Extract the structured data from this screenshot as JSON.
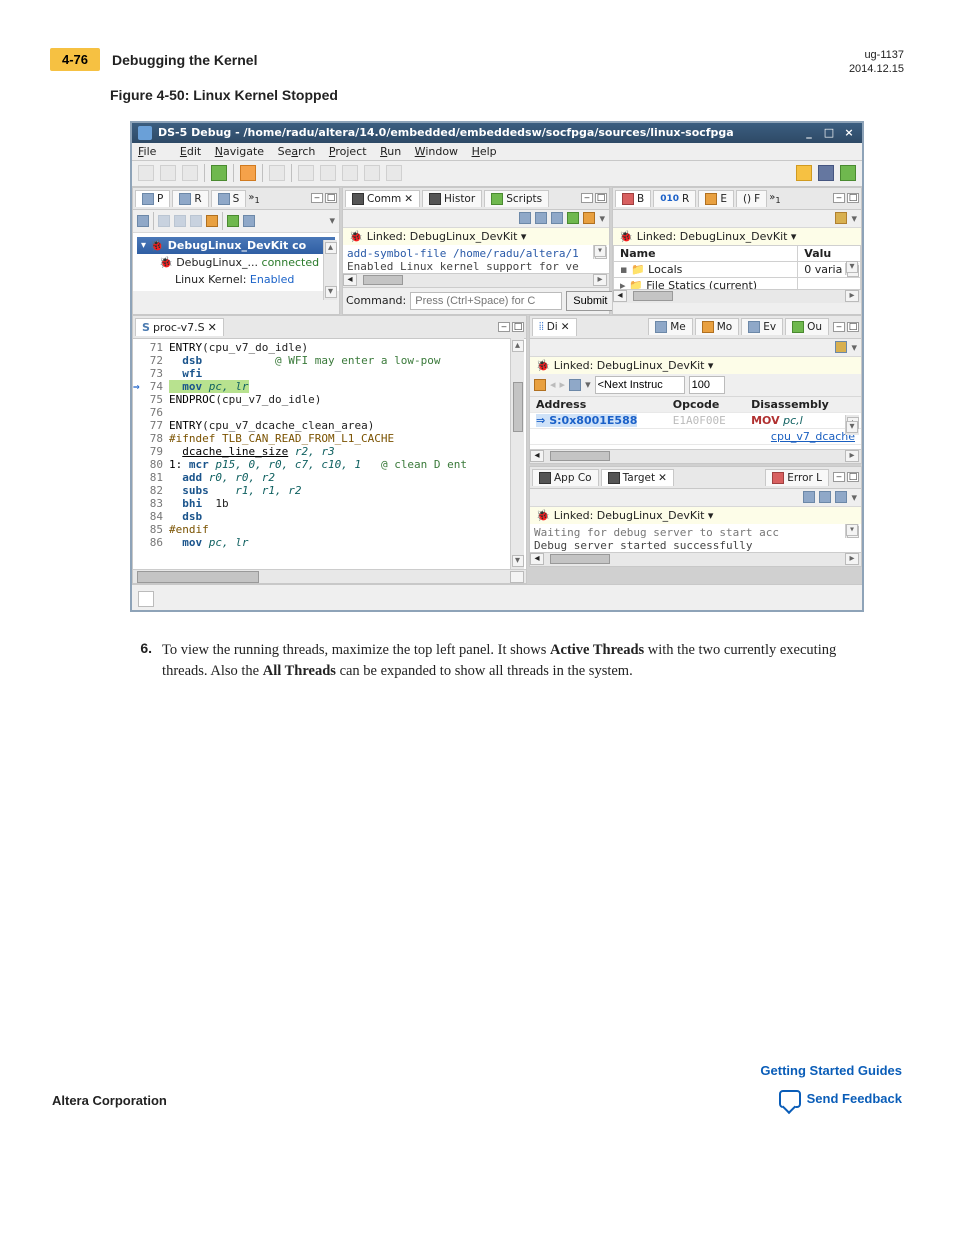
{
  "doc": {
    "page_number": "4-76",
    "section_title": "Debugging the Kernel",
    "doc_id": "ug-1137",
    "doc_date": "2014.12.15",
    "figure_caption": "Figure 4-50: Linux Kernel Stopped"
  },
  "window": {
    "title": "DS-5 Debug - /home/radu/altera/14.0/embedded/embeddedsw/socfpga/sources/linux-socfpga",
    "min": "_",
    "restore": "□",
    "close": "×"
  },
  "menubar": {
    "file": "File",
    "edit": "Edit",
    "navigate": "Navigate",
    "search": "Search",
    "project": "Project",
    "run": "Run",
    "window": "Window",
    "help": "Help"
  },
  "debug_control": {
    "tab_labels": [
      "P",
      "R",
      "S",
      "1"
    ],
    "selected": "DebugLinux_DevKit co",
    "status_line": "DebugLinux_... connected",
    "kernel_line_label": "Linux Kernel:",
    "kernel_line_value": "Enabled"
  },
  "commands": {
    "tab_comm": "Comm",
    "tab_histor": "Histor",
    "tab_scripts": "Scripts",
    "linked_label": "Linked: DebugLinux_DevKit",
    "line1": "add-symbol-file /home/radu/altera/1",
    "line2": "Enabled Linux kernel support for ve",
    "cmd_label": "Command:",
    "cmd_placeholder": "Press (Ctrl+Space) for C",
    "submit_label": "Submit"
  },
  "variables": {
    "tabs": [
      "B",
      "R",
      "E",
      "()",
      "F",
      "1"
    ],
    "linked_label": "Linked: DebugLinux_DevKit",
    "col_name": "Name",
    "col_value": "Valu",
    "row_locals": "Locals",
    "row_locals_val": "0 varia",
    "row_statics": "File Statics (current)"
  },
  "source": {
    "tab_label": "proc-v7.S",
    "lines": [
      {
        "n": "71",
        "t": "ENTRY",
        "a": "(cpu_v7_do_idle)"
      },
      {
        "n": "72",
        "i": "  ",
        "m": "dsb",
        "c": "          @ WFI may enter a low-pow"
      },
      {
        "n": "73",
        "i": "  ",
        "m": "wfi"
      },
      {
        "n": "74",
        "pc": true,
        "i": "  ",
        "m": "mov",
        "r": "pc, lr"
      },
      {
        "n": "75",
        "t": "ENDPROC",
        "a": "(cpu_v7_do_idle)"
      },
      {
        "n": "76"
      },
      {
        "n": "77",
        "t": "ENTRY",
        "a": "(cpu_v7_dcache_clean_area)"
      },
      {
        "n": "78",
        "d": "#ifndef TLB_CAN_READ_FROM_L1_CACHE"
      },
      {
        "n": "79",
        "i": "  ",
        "m2": "dcache_line_size",
        "r": "r2, r3"
      },
      {
        "n": "80",
        "lbl": "1:",
        "m": "mcr",
        "r": "p15, 0, r0, c7, c10, 1",
        "c": "   @ clean D ent"
      },
      {
        "n": "81",
        "i": "  ",
        "m": "add",
        "r": "r0, r0, r2"
      },
      {
        "n": "82",
        "i": "  ",
        "m": "subs",
        "r": "   r1, r1, r2"
      },
      {
        "n": "83",
        "i": "  ",
        "m": "bhi",
        "a2": "1b"
      },
      {
        "n": "84",
        "i": "  ",
        "m": "dsb"
      },
      {
        "n": "85",
        "d": "#endif"
      },
      {
        "n": "86",
        "i": "  ",
        "m": "mov",
        "r": "pc, lr"
      }
    ]
  },
  "disasm_tabs": {
    "tab_di": "Di",
    "tabs_right": [
      "Me",
      "Mo",
      "Ev",
      "Ou"
    ],
    "linked_label": "Linked: DebugLinux_DevKit",
    "next_label": "<Next Instruc",
    "next_value": "100",
    "col_addr": "Address",
    "col_opcode": "Opcode",
    "col_dis": "Disassembly",
    "row_addr": "S:0x8001E588",
    "row_mnem": "MOV",
    "row_args": "pc,l",
    "row_sym": "cpu_v7_dcache"
  },
  "target_pane": {
    "tab_app": "App Co",
    "tab_target": "Target",
    "tab_error": "Error L",
    "linked_label": "Linked: DebugLinux_DevKit",
    "line1": "Waiting for debug server to start acc",
    "line2": "Debug server started successfully"
  },
  "step": {
    "num": "6.",
    "text_pre": "To view the running threads, maximize the top left panel. It shows ",
    "bold1": "Active Threads",
    "text_mid": " with the two currently executing threads. Also the ",
    "bold2": "All Threads",
    "text_post": " can be expanded to show all threads in the system."
  },
  "footer": {
    "left": "Altera Corporation",
    "link": "Getting Started Guides",
    "feedback": "Send Feedback"
  }
}
